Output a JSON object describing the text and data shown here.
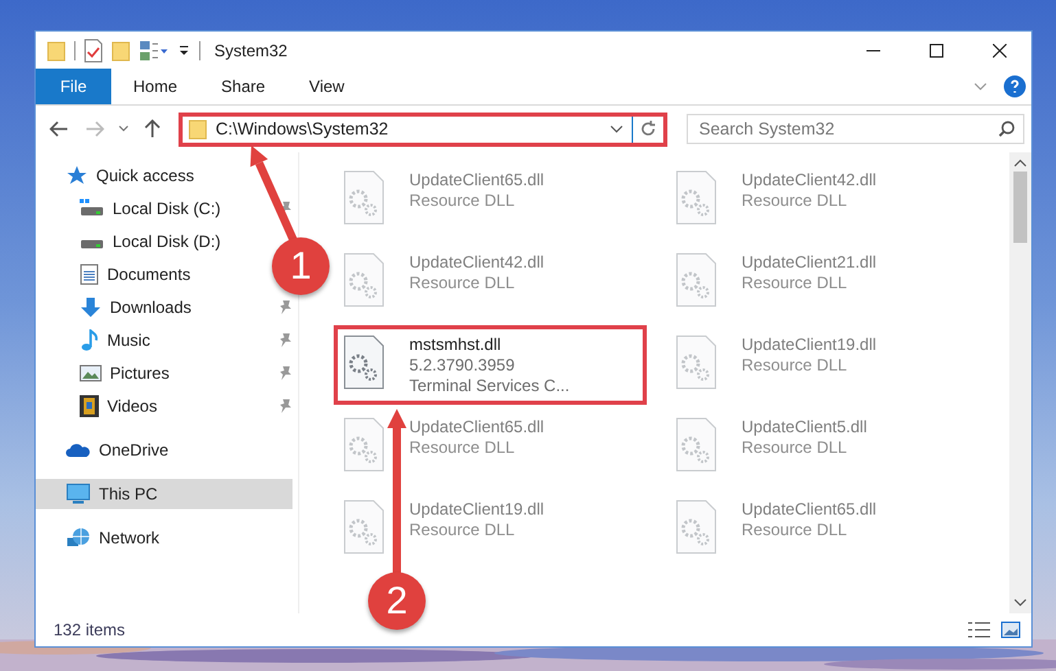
{
  "window": {
    "title": "System32"
  },
  "ribbon_tabs": [
    {
      "label": "File",
      "selected": true
    },
    {
      "label": "Home",
      "selected": false
    },
    {
      "label": "Share",
      "selected": false
    },
    {
      "label": "View",
      "selected": false
    }
  ],
  "address_bar": {
    "path": "C:\\Windows\\System32",
    "highlighted": true
  },
  "search": {
    "placeholder": "Search System32"
  },
  "navigation": [
    {
      "label": "Quick access",
      "kind": "star",
      "selected": false,
      "children": [
        {
          "label": "Local Disk (C:)",
          "kind": "system-drive",
          "selected": false,
          "pinned": true
        },
        {
          "label": "Local Disk (D:)",
          "kind": "drive",
          "selected": false
        },
        {
          "label": "Documents",
          "kind": "documents",
          "selected": false
        },
        {
          "label": "Downloads",
          "kind": "downloads",
          "selected": false,
          "pinned": true
        },
        {
          "label": "Music",
          "kind": "music",
          "selected": false,
          "pinned": true
        },
        {
          "label": "Pictures",
          "kind": "pictures",
          "selected": false,
          "pinned": true
        },
        {
          "label": "Videos",
          "kind": "videos",
          "selected": false,
          "pinned": true
        }
      ]
    },
    {
      "label": "OneDrive",
      "kind": "cloud",
      "selected": false
    },
    {
      "label": "This PC",
      "kind": "pc",
      "selected": true
    },
    {
      "label": "Network",
      "kind": "network",
      "selected": false
    }
  ],
  "files": [
    {
      "name": "UpdateClient65.dll",
      "lines": [
        "Resource DLL"
      ],
      "dimmed": true,
      "highlighted": false
    },
    {
      "name": "UpdateClient42.dll",
      "lines": [
        "Resource DLL"
      ],
      "dimmed": true,
      "highlighted": false
    },
    {
      "name": "UpdateClient42.dll",
      "lines": [
        "Resource DLL"
      ],
      "dimmed": true,
      "highlighted": false
    },
    {
      "name": "UpdateClient21.dll",
      "lines": [
        "Resource DLL"
      ],
      "dimmed": true,
      "highlighted": false
    },
    {
      "name": "mstsmhst.dll",
      "lines": [
        "5.2.3790.3959",
        "Terminal Services C..."
      ],
      "dimmed": false,
      "highlighted": true
    },
    {
      "name": "UpdateClient19.dll",
      "lines": [
        "Resource DLL"
      ],
      "dimmed": true,
      "highlighted": false
    },
    {
      "name": "UpdateClient65.dll",
      "lines": [
        "Resource DLL"
      ],
      "dimmed": true,
      "highlighted": false
    },
    {
      "name": "UpdateClient5.dll",
      "lines": [
        "Resource DLL"
      ],
      "dimmed": true,
      "highlighted": false
    },
    {
      "name": "UpdateClient19.dll",
      "lines": [
        "Resource DLL"
      ],
      "dimmed": true,
      "highlighted": false
    },
    {
      "name": "UpdateClient65.dll",
      "lines": [
        "Resource DLL"
      ],
      "dimmed": true,
      "highlighted": false
    }
  ],
  "status_bar": {
    "item_count": "132 items"
  },
  "annotations": [
    {
      "label": "1"
    },
    {
      "label": "2"
    }
  ]
}
